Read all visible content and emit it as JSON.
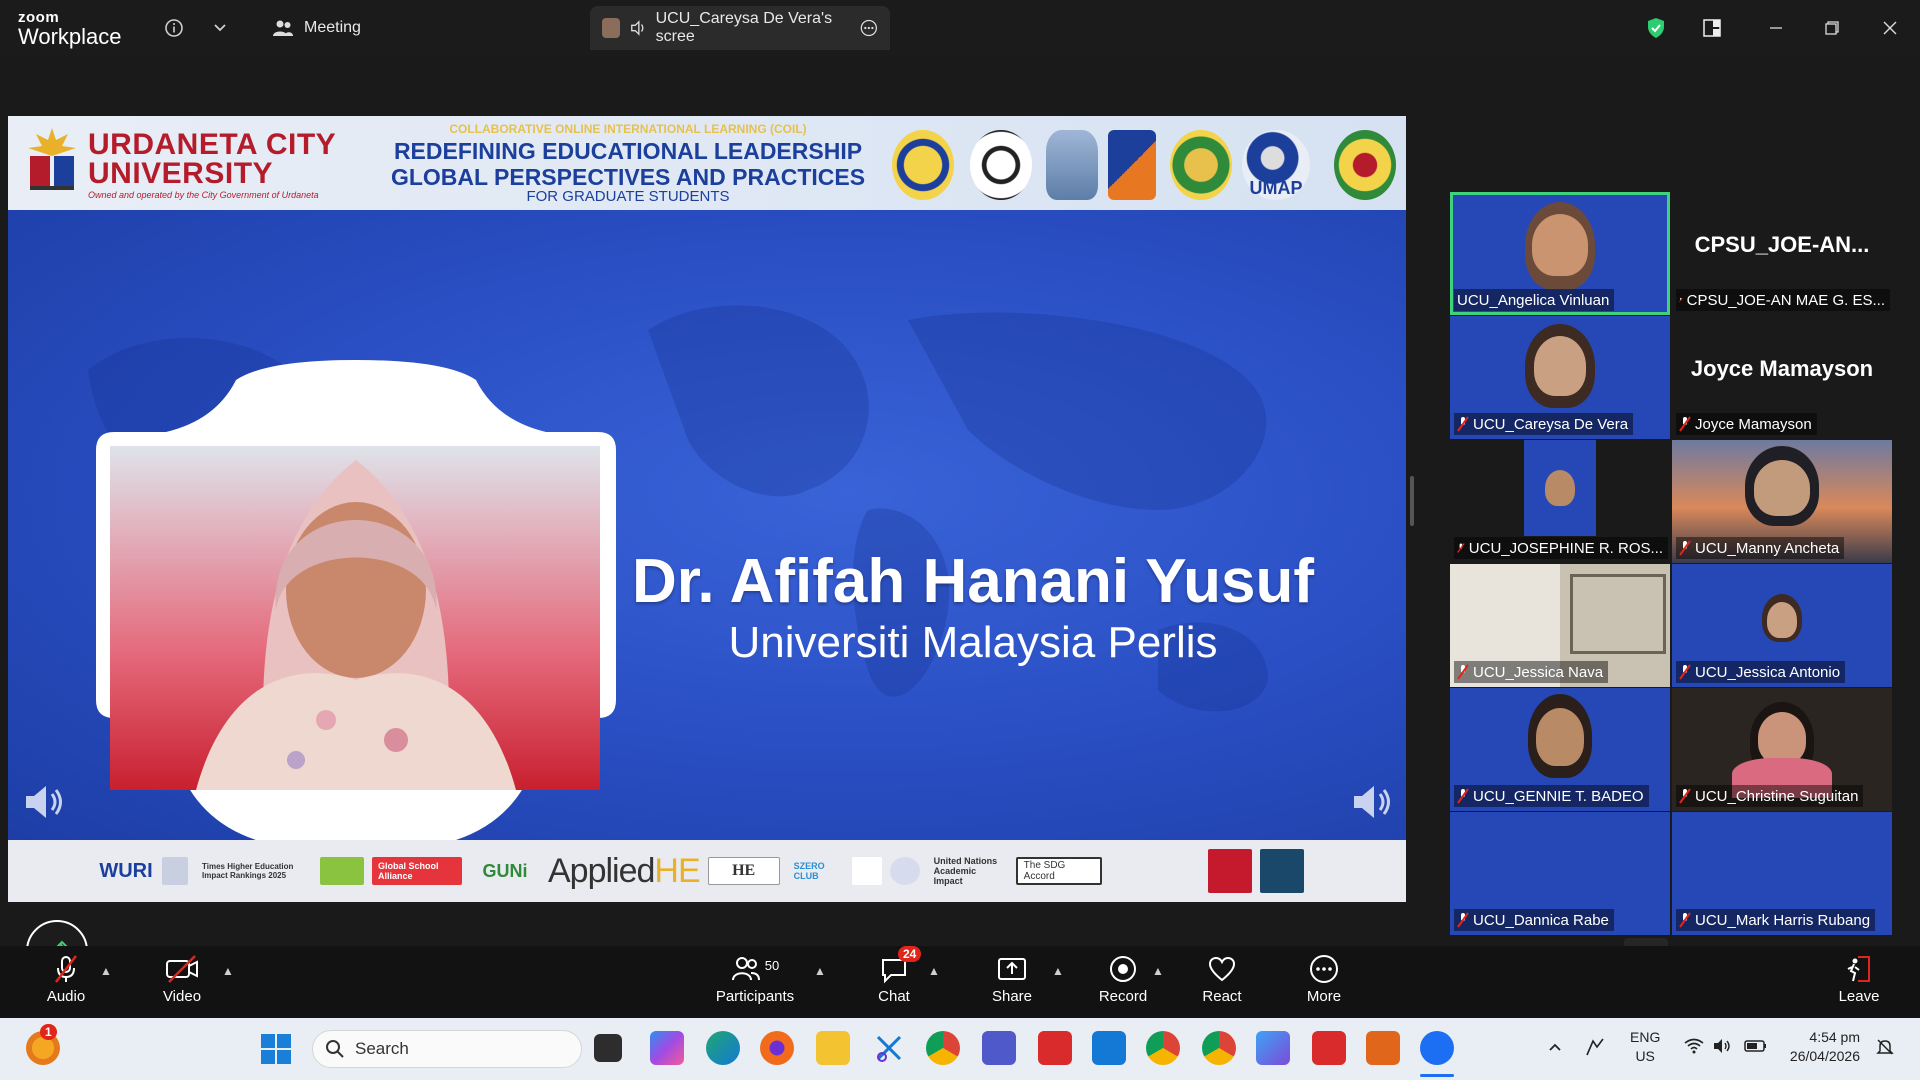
{
  "titlebar": {
    "brand_top": "zoom",
    "brand_bottom": "Workplace",
    "meeting_tab": "Meeting",
    "share_tab": "UCU_Careysa De Vera's scree"
  },
  "slide": {
    "university_name": "URDANETA CITY UNIVERSITY",
    "university_sub": "Owned and operated by the City Government of Urdaneta",
    "coil_line": "COLLABORATIVE ONLINE INTERNATIONAL LEARNING (COIL)",
    "headline_1": "REDEFINING EDUCATIONAL LEADERSHIP",
    "headline_2": "GLOBAL PERSPECTIVES AND PRACTICES",
    "headline_3": "FOR GRADUATE STUDENTS",
    "speaker_name": "Dr. Afifah Hanani Yusuf",
    "speaker_org": "Universiti Malaysia Perlis",
    "footer_applied": "Applied",
    "footer_he": "HE",
    "footer_sdg": "The SDG Accord",
    "footer_un": "United Nations Academic Impact",
    "footer_wuri": "WURI",
    "footer_guni": "GUNi",
    "footer_school": "Global School Alliance",
    "footer_impact": "Times Higher Education Impact Rankings 2025",
    "footer_szero": "SZERO CLUB",
    "footer_umap": "UMAP"
  },
  "gallery": [
    {
      "label": "UCU_Angelica Vinluan",
      "kind": "video",
      "muted": false,
      "active": true
    },
    {
      "label": "CPSU_JOE-AN MAE G. ES...",
      "kind": "name",
      "big": "CPSU_JOE-AN...",
      "muted": true
    },
    {
      "label": "UCU_Careysa De Vera",
      "kind": "video",
      "muted": true
    },
    {
      "label": "Joyce Mamayson",
      "kind": "name",
      "big": "Joyce Mamayson",
      "muted": true
    },
    {
      "label": "UCU_JOSEPHINE R. ROS...",
      "kind": "video",
      "muted": true
    },
    {
      "label": "UCU_Manny Ancheta",
      "kind": "video",
      "muted": true
    },
    {
      "label": "UCU_Jessica Nava",
      "kind": "video",
      "muted": true
    },
    {
      "label": "UCU_Jessica Antonio",
      "kind": "video",
      "muted": true
    },
    {
      "label": "UCU_GENNIE T. BADEO",
      "kind": "video",
      "muted": true
    },
    {
      "label": "UCU_Christine Suguitan",
      "kind": "video",
      "muted": true
    },
    {
      "label": "UCU_Dannica Rabe",
      "kind": "video",
      "muted": true
    },
    {
      "label": "UCU_Mark Harris Rubang",
      "kind": "video",
      "muted": true
    }
  ],
  "toolbar": {
    "audio": "Audio",
    "video": "Video",
    "participants": "Participants",
    "participants_count": "50",
    "chat": "Chat",
    "chat_badge": "24",
    "share": "Share",
    "record": "Record",
    "react": "React",
    "more": "More",
    "leave": "Leave"
  },
  "taskbar": {
    "search_placeholder": "Search",
    "notification_count": "1",
    "lang_top": "ENG",
    "lang_bottom": "US",
    "time": "4:54 pm",
    "date": "26/04/2026"
  },
  "colors": {
    "slide_blue": "#2548b8",
    "ucu_red": "#b51c2b",
    "heading_blue": "#1c3f9c",
    "active_speaker": "#3fd27c",
    "leave_red": "#e0261b"
  }
}
